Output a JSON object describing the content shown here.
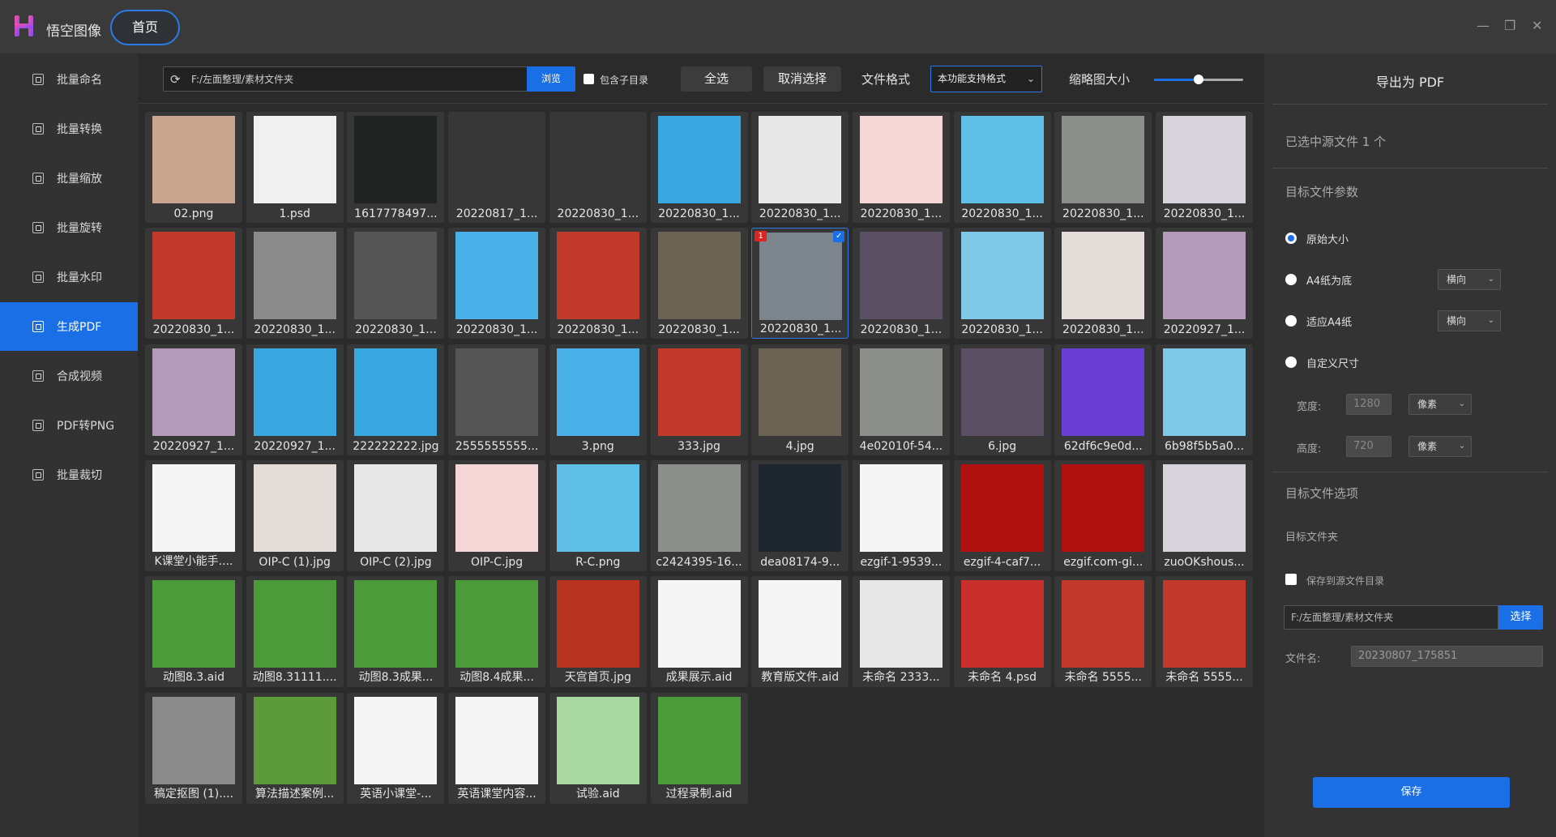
{
  "app": {
    "name": "悟空图像",
    "home_tab": "首页"
  },
  "window_controls": [
    "—",
    "❐",
    "✕"
  ],
  "sidebar": {
    "items": [
      {
        "label": "批量命名",
        "active": false
      },
      {
        "label": "批量转换",
        "active": false
      },
      {
        "label": "批量缩放",
        "active": false
      },
      {
        "label": "批量旋转",
        "active": false
      },
      {
        "label": "批量水印",
        "active": false
      },
      {
        "label": "生成PDF",
        "active": true
      },
      {
        "label": "合成视频",
        "active": false
      },
      {
        "label": "PDF转PNG",
        "active": false
      },
      {
        "label": "批量裁切",
        "active": false
      }
    ]
  },
  "toolbar": {
    "path": "F:/左面整理/素材文件夹",
    "browse": "浏览",
    "include_subdir": "包含子目录",
    "select_all": "全选",
    "deselect": "取消选择",
    "format_label": "文件格式",
    "format_value": "本功能支持格式",
    "thumb_size_label": "缩略图大小",
    "thumb_size": 0.5
  },
  "files": [
    {
      "name": "02.png",
      "color": "#c9a58f"
    },
    {
      "name": "1.psd",
      "color": "#f0f0f0"
    },
    {
      "name": "1617778497...",
      "color": "#1f2322"
    },
    {
      "name": "20220817_1...",
      "color": "#373737"
    },
    {
      "name": "20220830_1...",
      "color": "#373737"
    },
    {
      "name": "20220830_1...",
      "color": "#3aa8e0"
    },
    {
      "name": "20220830_1...",
      "color": "#e8e8e8"
    },
    {
      "name": "20220830_1...",
      "color": "#f4d6d6"
    },
    {
      "name": "20220830_1...",
      "color": "#5fbfe6"
    },
    {
      "name": "20220830_1...",
      "color": "#8c8f8a"
    },
    {
      "name": "20220830_1...",
      "color": "#d8d4dc"
    },
    {
      "name": "20220830_1...",
      "color": "#c0392b"
    },
    {
      "name": "20220830_1...",
      "color": "#8b8b8b"
    },
    {
      "name": "20220830_1...",
      "color": "#555555"
    },
    {
      "name": "20220830_1...",
      "color": "#4ab0e8"
    },
    {
      "name": "20220830_1...",
      "color": "#c0392b"
    },
    {
      "name": "20220830_1...",
      "color": "#6d6354"
    },
    {
      "name": "20220830_1...",
      "color": "#7d858c",
      "badge": "1",
      "selected": true
    },
    {
      "name": "20220830_1...",
      "color": "#5b4f63"
    },
    {
      "name": "20220830_1...",
      "color": "#7fc8e8"
    },
    {
      "name": "20220830_1...",
      "color": "#e3dcd8"
    },
    {
      "name": "20220927_1...",
      "color": "#b39ab8"
    },
    {
      "name": "20220927_1...",
      "color": "#b39ab8"
    },
    {
      "name": "20220927_1...",
      "color": "#3aa8e0"
    },
    {
      "name": "222222222.jpg",
      "color": "#3aa8e0"
    },
    {
      "name": "2555555555...",
      "color": "#555555"
    },
    {
      "name": "3.png",
      "color": "#4ab0e8"
    },
    {
      "name": "333.jpg",
      "color": "#c0392b"
    },
    {
      "name": "4.jpg",
      "color": "#6d6354"
    },
    {
      "name": "4e02010f-54...",
      "color": "#8c8f8a"
    },
    {
      "name": "6.jpg",
      "color": "#5b4f63"
    },
    {
      "name": "62df6c9e0d...",
      "color": "#6a3fd6"
    },
    {
      "name": "6b98f5b5a0...",
      "color": "#7fc8e8"
    },
    {
      "name": "K课堂小能手....",
      "color": "#f5f5f5"
    },
    {
      "name": "OIP-C (1).jpg",
      "color": "#e3dcd8"
    },
    {
      "name": "OIP-C (2).jpg",
      "color": "#e8e8e8"
    },
    {
      "name": "OIP-C.jpg",
      "color": "#f4d6d6"
    },
    {
      "name": "R-C.png",
      "color": "#5fbfe6"
    },
    {
      "name": "c2424395-16...",
      "color": "#8c8f8a"
    },
    {
      "name": "dea08174-9...",
      "color": "#1e2730"
    },
    {
      "name": "ezgif-1-9539...",
      "color": "#f5f5f5"
    },
    {
      "name": "ezgif-4-caf7...",
      "color": "#b01010"
    },
    {
      "name": "ezgif.com-gi...",
      "color": "#b01010"
    },
    {
      "name": "zuoOKshous...",
      "color": "#d8d4dc"
    },
    {
      "name": "动图8.3.aid",
      "color": "#4c9a3a"
    },
    {
      "name": "动图8.31111....",
      "color": "#4c9a3a"
    },
    {
      "name": "动图8.3成果...",
      "color": "#4c9a3a"
    },
    {
      "name": "动图8.4成果...",
      "color": "#4c9a3a"
    },
    {
      "name": "天宫首页.jpg",
      "color": "#b8331f"
    },
    {
      "name": "成果展示.aid",
      "color": "#f5f5f5"
    },
    {
      "name": "教育版文件.aid",
      "color": "#f5f5f5"
    },
    {
      "name": "未命名 2333...",
      "color": "#e8e8e8"
    },
    {
      "name": "未命名 4.psd",
      "color": "#c9302c"
    },
    {
      "name": "未命名 5555...",
      "color": "#c0392b"
    },
    {
      "name": "未命名 5555...",
      "color": "#c0392b"
    },
    {
      "name": "稿定抠图 (1)....",
      "color": "#8b8b8b"
    },
    {
      "name": "算法描述案例...",
      "color": "#5c9a3a"
    },
    {
      "name": "英语小课堂-...",
      "color": "#f5f5f5"
    },
    {
      "name": "英语课堂内容...",
      "color": "#f5f5f5"
    },
    {
      "name": "试验.aid",
      "color": "#a8d8a0"
    },
    {
      "name": "过程录制.aid",
      "color": "#4c9a3a"
    }
  ],
  "panel": {
    "title": "导出为 PDF",
    "selected_info": "已选中源文件 1 个",
    "target_params": "目标文件参数",
    "options": [
      {
        "label": "原始大小",
        "checked": true
      },
      {
        "label": "A4纸为底",
        "checked": false,
        "select": "横向"
      },
      {
        "label": "适应A4纸",
        "checked": false,
        "select": "横向"
      },
      {
        "label": "自定义尺寸",
        "checked": false
      }
    ],
    "width_label": "宽度:",
    "width_value": "1280",
    "width_unit": "像素",
    "height_label": "高度:",
    "height_value": "720",
    "height_unit": "像素",
    "target_options": "目标文件选项",
    "target_folder": "目标文件夹",
    "save_to_source": "保存到源文件目录",
    "output_path": "F:/左面整理/素材文件夹",
    "choose": "选择",
    "filename_label": "文件名:",
    "filename_value": "20230807_175851",
    "save": "保存"
  },
  "colors": {
    "accent": "#1a6fe6",
    "bg": "#2b2b2b"
  }
}
